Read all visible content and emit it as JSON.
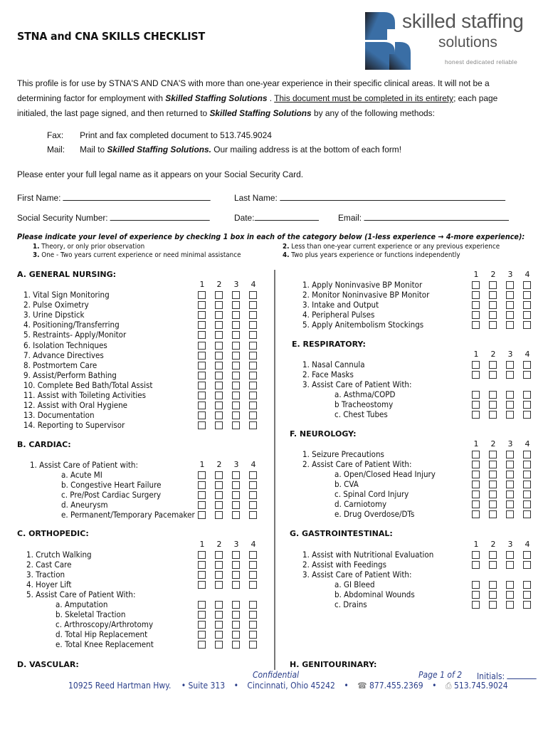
{
  "header": {
    "title": "STNA and CNA SKILLS CHECKLIST",
    "logo": {
      "line1": "skilled staffing",
      "line2": "solutions",
      "tagline": "honest  dedicated  reliable",
      "colors": {
        "blue": "#3a6ea5",
        "dark": "#2a2a2a"
      }
    }
  },
  "intro": {
    "p1": "This profile is for use by STNA'S AND CNA'S with more than one-year experience in their specific clinical areas.  It will not be a determining factor for employment with ",
    "company": "Skilled Staffing Solutions",
    "p2": " . ",
    "underlined": "This document must be completed in its entirety",
    "p3": "; each page initialed, the last page signed, and then returned to ",
    "p4": " by any of the following methods:"
  },
  "methods": [
    {
      "label": "Fax:",
      "text": "Print and fax completed document to 513.745.9024"
    },
    {
      "label": "Mail:",
      "text_pre": "Mail to ",
      "company": "Skilled Staffing Solutions.",
      "text_post": "  Our mailing address is at the bottom of each form!"
    }
  ],
  "name_note": "Please enter your full legal name as it appears on your Social Security Card.",
  "fields": {
    "first_name": {
      "label": "First Name:",
      "value": ""
    },
    "last_name": {
      "label": "Last Name:",
      "value": ""
    },
    "ssn": {
      "label": "Social Security Number:",
      "value": ""
    },
    "date": {
      "label": "Date:",
      "value": ""
    },
    "email": {
      "label": "Email:",
      "value": ""
    }
  },
  "instructions": {
    "heading": "Please indicate your level of experience by checking 1 box in each of the category below (1-less experience → 4-more experience):",
    "levels": [
      {
        "num": "1.",
        "text": "Theory, or only prior observation"
      },
      {
        "num": "2.",
        "text": "Less than one-year current experience or any previous experience"
      },
      {
        "num": "3.",
        "text": "One - Two years current experience or need minimal assistance"
      },
      {
        "num": "4.",
        "text": "Two plus years experience or functions independently"
      }
    ]
  },
  "column_numbers": [
    "1",
    "2",
    "3",
    "4"
  ],
  "sections": {
    "A": {
      "title": "A. GENERAL NURSING:",
      "items": [
        "1. Vital Sign Monitoring",
        "2.  Pulse Oximetry",
        "3.  Urine Dipstick",
        "4.  Positioning/Transferring",
        "5. Restraints- Apply/Monitor",
        "6. Isolation Techniques",
        "7. Advance Directives",
        "8. Postmortem Care",
        "9. Assist/Perform Bathing",
        "10. Complete Bed Bath/Total Assist",
        "11. Assist with Toileting Activities",
        "12. Assist with Oral Hygiene",
        "13. Documentation",
        "14. Reporting to Supervisor"
      ]
    },
    "B": {
      "title": "B. CARDIAC:",
      "group": "1.  Assist Care of Patient with:",
      "items": [
        "a. Acute MI",
        "b. Congestive Heart Failure",
        "c. Pre/Post Cardiac Surgery",
        "d. Aneurysm",
        "e. Permanent/Temporary Pacemaker"
      ]
    },
    "C": {
      "title": "C. ORTHOPEDIC:",
      "items": [
        "1. Crutch Walking",
        "2.  Cast Care",
        "3.  Traction",
        "4.   Hoyer Lift"
      ],
      "group": "5.   Assist Care of Patient With:",
      "subitems": [
        "a. Amputation",
        "b. Skeletal Traction",
        "c. Arthroscopy/Arthrotomy",
        "d. Total Hip Replacement",
        "e. Total Knee Replacement"
      ]
    },
    "D": {
      "title": "D. VASCULAR:",
      "items": [
        "1. Apply Noninvasive BP Monitor",
        "2. Monitor Noninvasive BP Monitor",
        "3. Intake and Output",
        "4. Peripheral Pulses",
        "5. Apply Anitembolism Stockings"
      ]
    },
    "E": {
      "title": "E. RESPIRATORY:",
      "items": [
        "1. Nasal Cannula",
        "2. Face Masks"
      ],
      "group": "3. Assist Care of Patient With:",
      "subitems": [
        "a. Asthma/COPD",
        "b Tracheostomy",
        "c. Chest Tubes"
      ]
    },
    "F": {
      "title": "F.  NEUROLOGY:",
      "items": [
        "1. Seizure Precautions",
        "2. Assist Care of Patient With:"
      ],
      "subitems": [
        "a. Open/Closed Head Injury",
        "b. CVA",
        "c. Spinal Cord Injury",
        "d. Carniotomy",
        "e. Drug Overdose/DTs"
      ]
    },
    "G": {
      "title": "G.  GASTROINTESTINAL:",
      "items": [
        "1. Assist with Nutritional Evaluation",
        "2. Assist with Feedings"
      ],
      "group": "3. Assist Care of Patient With:",
      "subitems": [
        "a. GI Bleed",
        "b. Abdominal Wounds",
        "c. Drains"
      ]
    },
    "H": {
      "title": "H.  GENITOURINARY:"
    }
  },
  "footer": {
    "confidential": "Confidential",
    "page": "Page 1 of 2",
    "initials_label": "Initials:",
    "initials_value": "",
    "address": "10925 Reed Hartman Hwy.",
    "suite": "• Suite 313",
    "city": "Cincinnati, Ohio 45242",
    "phone": "877.455.2369",
    "fax": "513.745.9024",
    "bullet": "•",
    "phone_icon": "☎",
    "fax_icon": "⎙"
  }
}
